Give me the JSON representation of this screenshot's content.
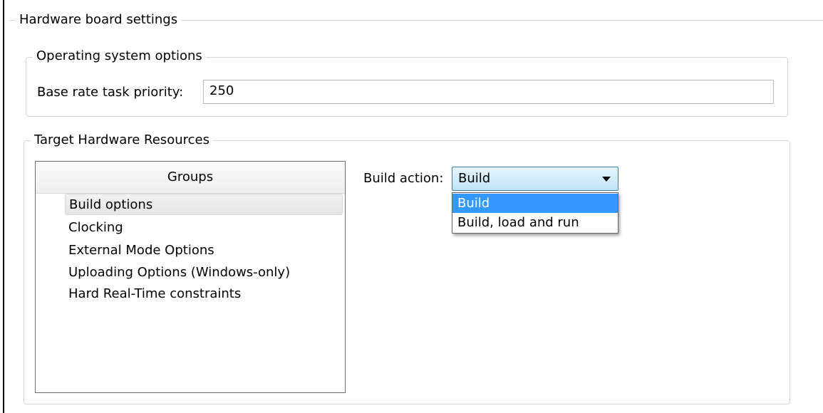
{
  "hardware_board_settings": {
    "title": "Hardware board settings"
  },
  "os_options": {
    "title": "Operating system options",
    "base_rate_label": "Base rate task priority:",
    "base_rate_value": "250"
  },
  "target_resources": {
    "title": "Target Hardware Resources",
    "groups_header": "Groups",
    "groups": [
      "Build options",
      "Clocking",
      "External Mode Options",
      "Uploading Options (Windows-only)",
      "Hard Real-Time constraints"
    ],
    "selected_group": "Build options",
    "build_action_label": "Build action:",
    "build_action_value": "Build",
    "build_action_options": [
      "Build",
      "Build, load and run"
    ],
    "highlighted_option": "Build"
  },
  "colors": {
    "combo_border": "#3d7bad",
    "dropdown_highlight": "#3399ff",
    "group_border": "#d5d5d5"
  }
}
